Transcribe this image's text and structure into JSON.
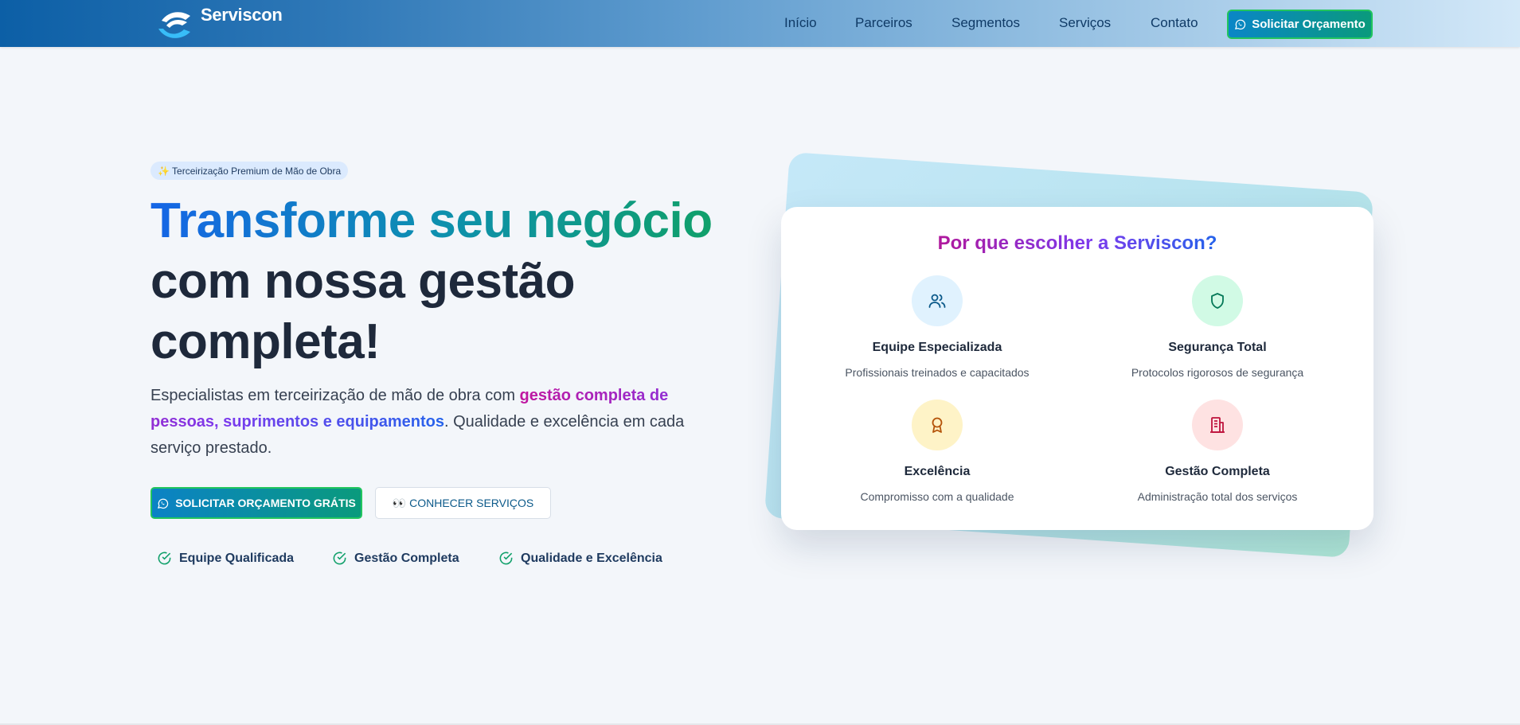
{
  "brand": {
    "name": "Serviscon"
  },
  "nav": {
    "items": [
      {
        "label": "Início"
      },
      {
        "label": "Parceiros"
      },
      {
        "label": "Segmentos"
      },
      {
        "label": "Serviços"
      },
      {
        "label": "Contato"
      }
    ],
    "cta_label": "Solicitar Orçamento"
  },
  "hero": {
    "badge": "✨ Terceirização Premium de Mão de Obra",
    "title_gradient": "Transforme seu negócio",
    "title_rest": "com nossa gestão completa!",
    "desc_start": "Especialistas em terceirização de mão de obra com ",
    "desc_highlight": "gestão completa de pessoas, suprimentos e equipamentos",
    "desc_end": ". Qualidade e excelência em cada serviço prestado.",
    "primary_button": "SOLICITAR ORÇAMENTO GRÁTIS",
    "secondary_button": "👀 CONHECER SERVIÇOS",
    "features": [
      {
        "label": "Equipe Qualificada"
      },
      {
        "label": "Gestão Completa"
      },
      {
        "label": "Qualidade e Excelência"
      }
    ]
  },
  "card": {
    "title": "Por que escolher a Serviscon?",
    "items": [
      {
        "icon": "users-icon",
        "title": "Equipe Especializada",
        "desc": "Profissionais treinados e capacitados",
        "bg": "#e0f2fe",
        "color": "#0c5a8a"
      },
      {
        "icon": "shield-icon",
        "title": "Segurança Total",
        "desc": "Protocolos rigorosos de segurança",
        "bg": "#d1fae5",
        "color": "#047857"
      },
      {
        "icon": "award-icon",
        "title": "Excelência",
        "desc": "Compromisso com a qualidade",
        "bg": "#fef3c7",
        "color": "#b45309"
      },
      {
        "icon": "building-icon",
        "title": "Gestão Completa",
        "desc": "Administração total dos serviços",
        "bg": "#fee2e2",
        "color": "#be123c"
      }
    ]
  },
  "colors": {
    "header_start": "#0c5fa6",
    "accent_green": "#10a06a",
    "accent_blue": "#1565e6",
    "accent_magenta": "#c0169f"
  }
}
